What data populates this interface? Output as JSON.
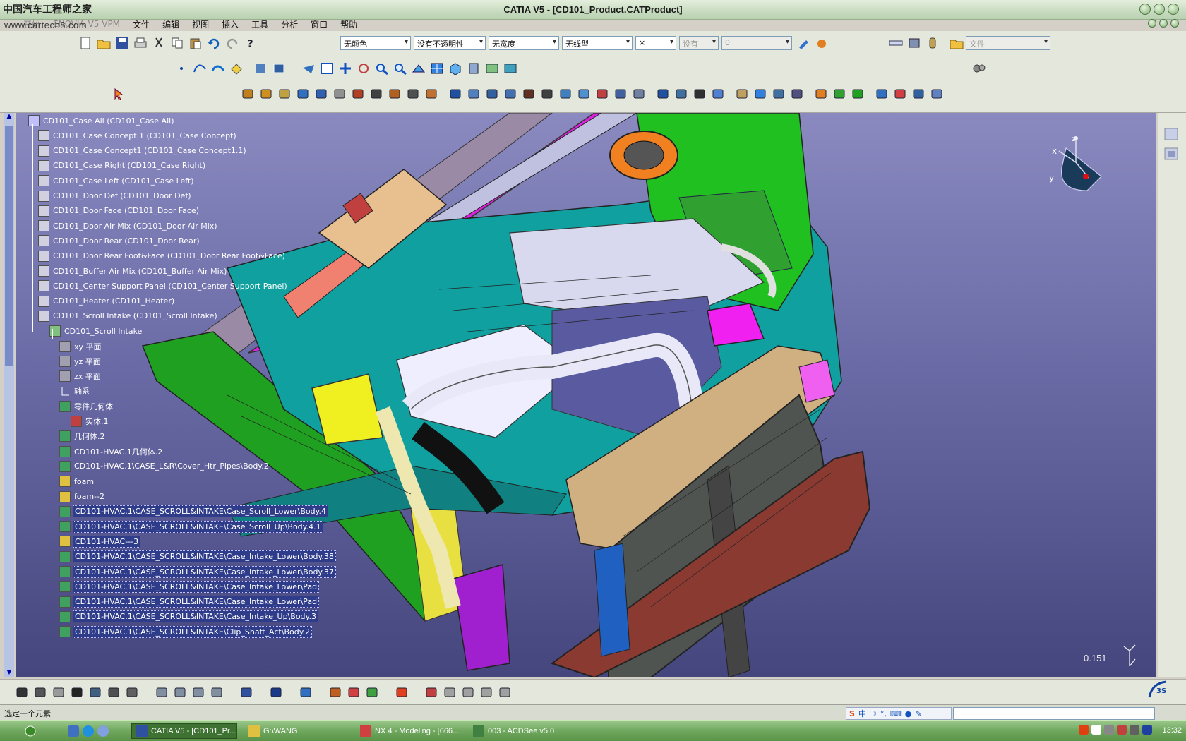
{
  "window": {
    "title": "CATIA V5 - [CD101_Product.CATProduct]",
    "watermark_cn": "中国汽车工程师之家",
    "watermark_url": "www.cartech8.com"
  },
  "menu": [
    "开始",
    "ENOVIA V5 VPM",
    "文件",
    "编辑",
    "视图",
    "插入",
    "工具",
    "分析",
    "窗口",
    "帮助"
  ],
  "toolbar": {
    "color_combo": "无颜色",
    "opacity_combo": "没有不透明性",
    "width_combo": "无宽度",
    "linetype_combo": "无线型",
    "x_combo": "×",
    "layer_combo": "设有",
    "value_combo": "0",
    "file_combo": "文件"
  },
  "tree": [
    {
      "label": "CD101_Case All (CD101_Case All)",
      "level": 0,
      "icon": "product-icon",
      "sel": false
    },
    {
      "label": "CD101_Case Concept.1 (CD101_Case Concept)",
      "level": 1,
      "icon": "part-icon",
      "sel": false
    },
    {
      "label": "CD101_Case Concept1 (CD101_Case Concept1.1)",
      "level": 1,
      "icon": "part-icon",
      "sel": false
    },
    {
      "label": "CD101_Case Right (CD101_Case Right)",
      "level": 1,
      "icon": "part-icon",
      "sel": false
    },
    {
      "label": "CD101_Case Left (CD101_Case Left)",
      "level": 1,
      "icon": "part-icon",
      "sel": false
    },
    {
      "label": "CD101_Door Def (CD101_Door Def)",
      "level": 1,
      "icon": "part-icon",
      "sel": false
    },
    {
      "label": "CD101_Door Face (CD101_Door Face)",
      "level": 1,
      "icon": "part-icon",
      "sel": false
    },
    {
      "label": "CD101_Door Air Mix (CD101_Door Air Mix)",
      "level": 1,
      "icon": "part-icon",
      "sel": false
    },
    {
      "label": "CD101_Door Rear (CD101_Door Rear)",
      "level": 1,
      "icon": "part-icon",
      "sel": false
    },
    {
      "label": "CD101_Door Rear Foot&Face (CD101_Door Rear Foot&Face)",
      "level": 1,
      "icon": "part-icon",
      "sel": false
    },
    {
      "label": "CD101_Buffer Air Mix (CD101_Buffer Air Mix)",
      "level": 1,
      "icon": "part-icon",
      "sel": false
    },
    {
      "label": "CD101_Center Support Panel (CD101_Center Support Panel)",
      "level": 1,
      "icon": "part-icon",
      "sel": false
    },
    {
      "label": "CD101_Heater (CD101_Heater)",
      "level": 1,
      "icon": "part-icon",
      "sel": false
    },
    {
      "label": "CD101_Scroll Intake (CD101_Scroll Intake)",
      "level": 1,
      "icon": "part-icon",
      "sel": false
    },
    {
      "label": "CD101_Scroll Intake",
      "level": 2,
      "icon": "partbody-icon",
      "sel": false
    },
    {
      "label": "xy 平面",
      "level": 3,
      "icon": "plane-icon",
      "sel": false
    },
    {
      "label": "yz 平面",
      "level": 3,
      "icon": "plane-icon",
      "sel": false
    },
    {
      "label": "zx 平面",
      "level": 3,
      "icon": "plane-icon",
      "sel": false
    },
    {
      "label": "轴系",
      "level": 3,
      "icon": "axis-icon",
      "sel": false
    },
    {
      "label": "零件几何体",
      "level": 3,
      "icon": "body-icon",
      "sel": false
    },
    {
      "label": "实体.1",
      "level": 4,
      "icon": "solid-icon",
      "sel": false
    },
    {
      "label": "几何体.2",
      "level": 3,
      "icon": "body-icon",
      "sel": false
    },
    {
      "label": "CD101-HVAC.1几何体.2",
      "level": 3,
      "icon": "body-icon",
      "sel": false
    },
    {
      "label": "CD101-HVAC.1\\CASE_L&R\\Cover_Htr_Pipes\\Body.2",
      "level": 3,
      "icon": "body-icon",
      "sel": false
    },
    {
      "label": "foam",
      "level": 3,
      "icon": "gear-body-icon",
      "sel": false
    },
    {
      "label": "foam--2",
      "level": 3,
      "icon": "gear-body-icon",
      "sel": false
    },
    {
      "label": "CD101-HVAC.1\\CASE_SCROLL&INTAKE\\Case_Scroll_Lower\\Body.4",
      "level": 3,
      "icon": "body-icon",
      "sel": true
    },
    {
      "label": "CD101-HVAC.1\\CASE_SCROLL&INTAKE\\Case_Scroll_Up\\Body.4.1",
      "level": 3,
      "icon": "body-icon",
      "sel": true
    },
    {
      "label": "CD101-HVAC---3",
      "level": 3,
      "icon": "gear-body-icon",
      "sel": true
    },
    {
      "label": "CD101-HVAC.1\\CASE_SCROLL&INTAKE\\Case_Intake_Lower\\Body.38",
      "level": 3,
      "icon": "body-icon",
      "sel": true
    },
    {
      "label": "CD101-HVAC.1\\CASE_SCROLL&INTAKE\\Case_Intake_Lower\\Body.37",
      "level": 3,
      "icon": "body-icon",
      "sel": true
    },
    {
      "label": "CD101-HVAC.1\\CASE_SCROLL&INTAKE\\Case_Intake_Lower\\Pad",
      "level": 3,
      "icon": "body-icon",
      "sel": true
    },
    {
      "label": "CD101-HVAC.1\\CASE_SCROLL&INTAKE\\Case_Intake_Lower\\Pad",
      "level": 3,
      "icon": "body-icon",
      "sel": true
    },
    {
      "label": "CD101-HVAC.1\\CASE_SCROLL&INTAKE\\Case_Intake_Up\\Body.3",
      "level": 3,
      "icon": "body-icon",
      "sel": true
    },
    {
      "label": "CD101-HVAC.1\\CASE_SCROLL&INTAKE\\Clip_Shaft_Act\\Body.2",
      "level": 3,
      "icon": "body-icon",
      "sel": true
    }
  ],
  "viewport": {
    "scale": "0.151",
    "compass_x": "x",
    "compass_y": "y",
    "compass_z": "z"
  },
  "status": {
    "message": "选定一个元素",
    "ime_label": "中"
  },
  "taskbar": {
    "start": "开始",
    "tasks": [
      {
        "label": "CATIA V5 - [CD101_Pr...",
        "active": true
      },
      {
        "label": "G:\\WANG",
        "active": false
      },
      {
        "label": "NX 4 - Modeling - [666...",
        "active": false
      },
      {
        "label": "003 - ACDSee v5.0",
        "active": false
      }
    ],
    "clock": "13:32"
  },
  "colors": {
    "viewport_top": "#8a8ac0",
    "viewport_bottom": "#46467e",
    "selection": "#2e3c8a",
    "taskbar": "#6fa85e"
  }
}
